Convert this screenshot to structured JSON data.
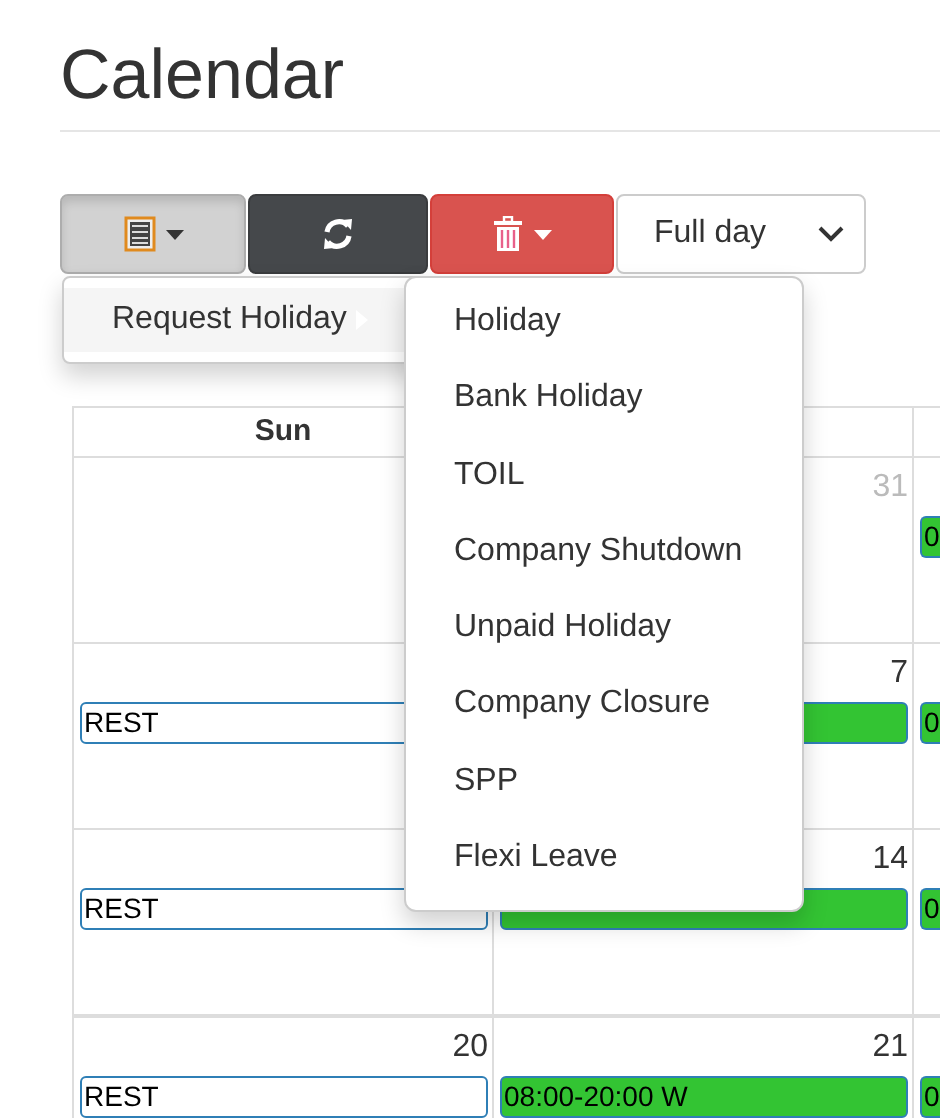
{
  "title": "Calendar",
  "toolbar": {
    "buttons": [
      {
        "kind": "menu",
        "expanded": true
      },
      {
        "kind": "refresh"
      },
      {
        "kind": "delete"
      }
    ],
    "select": {
      "value": "Full day"
    }
  },
  "menu": {
    "items": [
      {
        "label": "Request Holiday",
        "selected": true
      }
    ],
    "submenu": [
      {
        "label": "Holiday"
      },
      {
        "label": "Bank Holiday"
      },
      {
        "label": "TOIL"
      },
      {
        "label": "Company Shutdown"
      },
      {
        "label": "Unpaid Holiday"
      },
      {
        "label": "Company Closure"
      },
      {
        "label": "SPP"
      },
      {
        "label": "Flexi Leave"
      }
    ]
  },
  "calendar": {
    "headers": [
      "Sun"
    ],
    "weeks": [
      {
        "days": [
          {
            "kind": "blank"
          },
          {
            "kind": "day",
            "date": "31",
            "other_month": true
          },
          {
            "kind": "day",
            "event": {
              "kind": "shift",
              "text": "0"
            }
          }
        ]
      },
      {
        "days": [
          {
            "kind": "day",
            "event": {
              "kind": "rest",
              "text": "REST"
            }
          },
          {
            "kind": "day",
            "date": "7",
            "event": {
              "kind": "shift"
            }
          },
          {
            "kind": "day",
            "event": {
              "kind": "shift",
              "text": "0"
            }
          }
        ]
      },
      {
        "days": [
          {
            "kind": "day",
            "event": {
              "kind": "rest",
              "text": "REST"
            }
          },
          {
            "kind": "day",
            "date": "14",
            "event": {
              "kind": "shift"
            }
          },
          {
            "kind": "day",
            "event": {
              "kind": "shift",
              "text": "0"
            }
          }
        ]
      },
      {
        "days": [
          {
            "kind": "day",
            "date": "20",
            "event": {
              "kind": "rest",
              "text": "REST"
            }
          },
          {
            "kind": "day",
            "date": "21",
            "event": {
              "kind": "shift",
              "text": "08:00-20:00 W"
            }
          },
          {
            "kind": "day",
            "event": {
              "kind": "shift",
              "text": "0"
            }
          }
        ]
      }
    ]
  }
}
